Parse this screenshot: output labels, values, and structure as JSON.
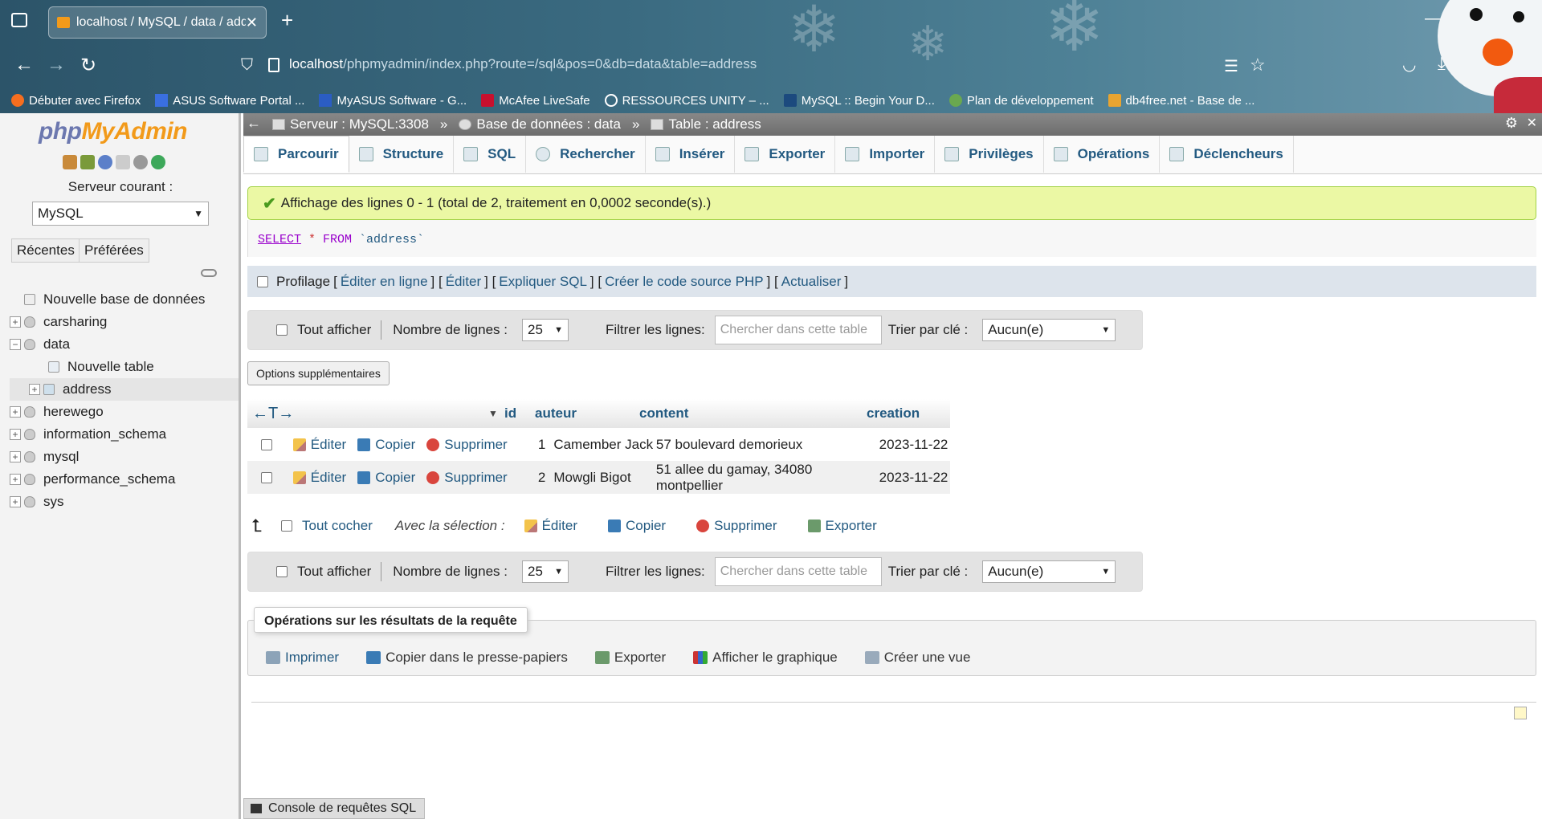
{
  "browser": {
    "tab_title": "localhost / MySQL / data / address",
    "url_host": "localhost",
    "url_path": "/phpmyadmin/index.php?route=/sql&pos=0&db=data&table=address",
    "bookmarks": [
      "Débuter avec Firefox",
      "ASUS Software Portal ...",
      "MyASUS Software - G...",
      "McAfee LiveSafe",
      "RESSOURCES UNITY – ...",
      "MySQL :: Begin Your D...",
      "Plan de développement",
      "db4free.net - Base de ..."
    ]
  },
  "sidebar": {
    "logo_php": "php",
    "logo_myadmin": "MyAdmin",
    "server_label": "Serveur courant :",
    "server_value": "MySQL",
    "recent_label": "Récentes",
    "favorites_label": "Préférées",
    "tree": {
      "new_db": "Nouvelle base de données",
      "carsharing": "carsharing",
      "data": "data",
      "new_table": "Nouvelle table",
      "address": "address",
      "herewego": "herewego",
      "information_schema": "information_schema",
      "mysql": "mysql",
      "performance_schema": "performance_schema",
      "sys": "sys"
    }
  },
  "breadcrumb": {
    "server": "Serveur : MySQL:3308",
    "database": "Base de données : data",
    "table": "Table : address"
  },
  "tabs": {
    "browse": "Parcourir",
    "structure": "Structure",
    "sql": "SQL",
    "search": "Rechercher",
    "insert": "Insérer",
    "export": "Exporter",
    "import": "Importer",
    "privileges": "Privilèges",
    "operations": "Opérations",
    "triggers": "Déclencheurs"
  },
  "message": "Affichage des lignes 0 - 1 (total de 2, traitement en 0,0002 seconde(s).)",
  "query": {
    "select": "SELECT",
    "star": " * ",
    "from": "FROM",
    "table": " `address`"
  },
  "profiling": {
    "label": "Profilage",
    "inline_edit": "Éditer en ligne",
    "edit": "Éditer",
    "explain": "Expliquer SQL",
    "php_code": "Créer le code source PHP",
    "refresh": "Actualiser"
  },
  "nav": {
    "show_all": "Tout afficher",
    "rows_label": "Nombre de lignes :",
    "rows_value": "25",
    "filter_label": "Filtrer les lignes:",
    "filter_placeholder": "Chercher dans cette table",
    "sort_label": "Trier par clé :",
    "sort_value": "Aucun(e)"
  },
  "extra_options": "Options supplémentaires",
  "table": {
    "headers": {
      "id": "id",
      "auteur": "auteur",
      "content": "content",
      "creation": "creation"
    },
    "row_actions": {
      "edit": "Éditer",
      "copy": "Copier",
      "delete": "Supprimer"
    },
    "rows": [
      {
        "id": "1",
        "auteur": "Camember Jack",
        "content": "57 boulevard demorieux",
        "creation": "2023-11-22"
      },
      {
        "id": "2",
        "auteur": "Mowgli Bigot",
        "content": "51 allee du gamay, 34080 montpellier",
        "creation": "2023-11-22"
      }
    ]
  },
  "bulk": {
    "check_all": "Tout cocher",
    "with_selection": "Avec la sélection :",
    "edit": "Éditer",
    "copy": "Copier",
    "delete": "Supprimer",
    "export": "Exporter"
  },
  "query_ops": {
    "legend": "Opérations sur les résultats de la requête",
    "print": "Imprimer",
    "copy_clipboard": "Copier dans le presse-papiers",
    "export": "Exporter",
    "chart": "Afficher le graphique",
    "create_view": "Créer une vue"
  },
  "console": "Console de requêtes SQL"
}
